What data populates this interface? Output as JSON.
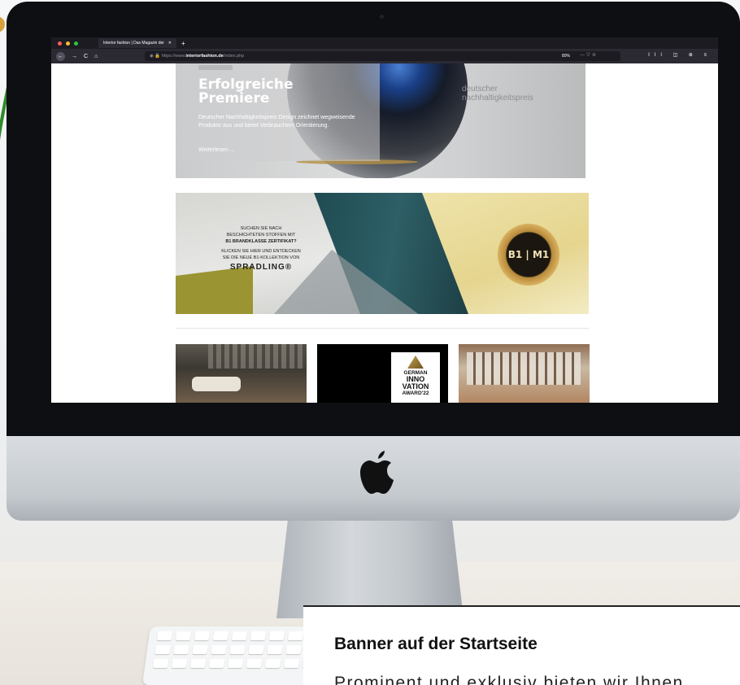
{
  "browser": {
    "tab_title": "Interior fashion | Das Magazin der",
    "tab_close": "✕",
    "new_tab": "+",
    "url_prefix": "https://www.",
    "url_domain": "interiorfashion.de",
    "url_path": "/index.php",
    "zoom": "80%",
    "nav_back": "←",
    "nav_forward": "→",
    "nav_reload": "C",
    "nav_home": "⌂",
    "url_icons": "··· ♡ ☆",
    "tool_icons": "IIl ◫ ⊕ ≡"
  },
  "hero": {
    "title_line1": "Erfolgreiche",
    "title_line2": "Premiere",
    "text": "Deutscher Nachhaltigkeitspreis Design zeichnet wegweisende Produkte aus und bietet Verbrauchern Orientierung.",
    "more": "Weiterlesen ...",
    "logo_line1": "deutscher",
    "logo_line2": "nachhaltigkeitspreis"
  },
  "banner": {
    "line1": "SUCHEN SIE NACH",
    "line2": "BESCHICHTETEN STOFFEN MIT",
    "line3": "B1 BRANDKLASSE ZERTIFIKAT?",
    "line4": "KLICKEN SIE HIER UND ENTDECKEN",
    "line5": "SIE DIE NEUE B1-KOLLEKTION VON",
    "brand": "SPRADLING®",
    "seal": "B1 | M1"
  },
  "tiles": {
    "award_line1": "GERMAN",
    "award_line2": "INNO",
    "award_line3": "VATION",
    "award_line4": "AWARD'22"
  },
  "card": {
    "title": "Banner auf der Startseite",
    "text": "Prominent und exklusiv bieten wir Ihnen"
  },
  "colors": {
    "bezel": "#0d0f12",
    "browser_chrome": "#2b2a33",
    "traffic_red": "#ff5f57",
    "traffic_yellow": "#febc2e",
    "traffic_green": "#28c840"
  }
}
